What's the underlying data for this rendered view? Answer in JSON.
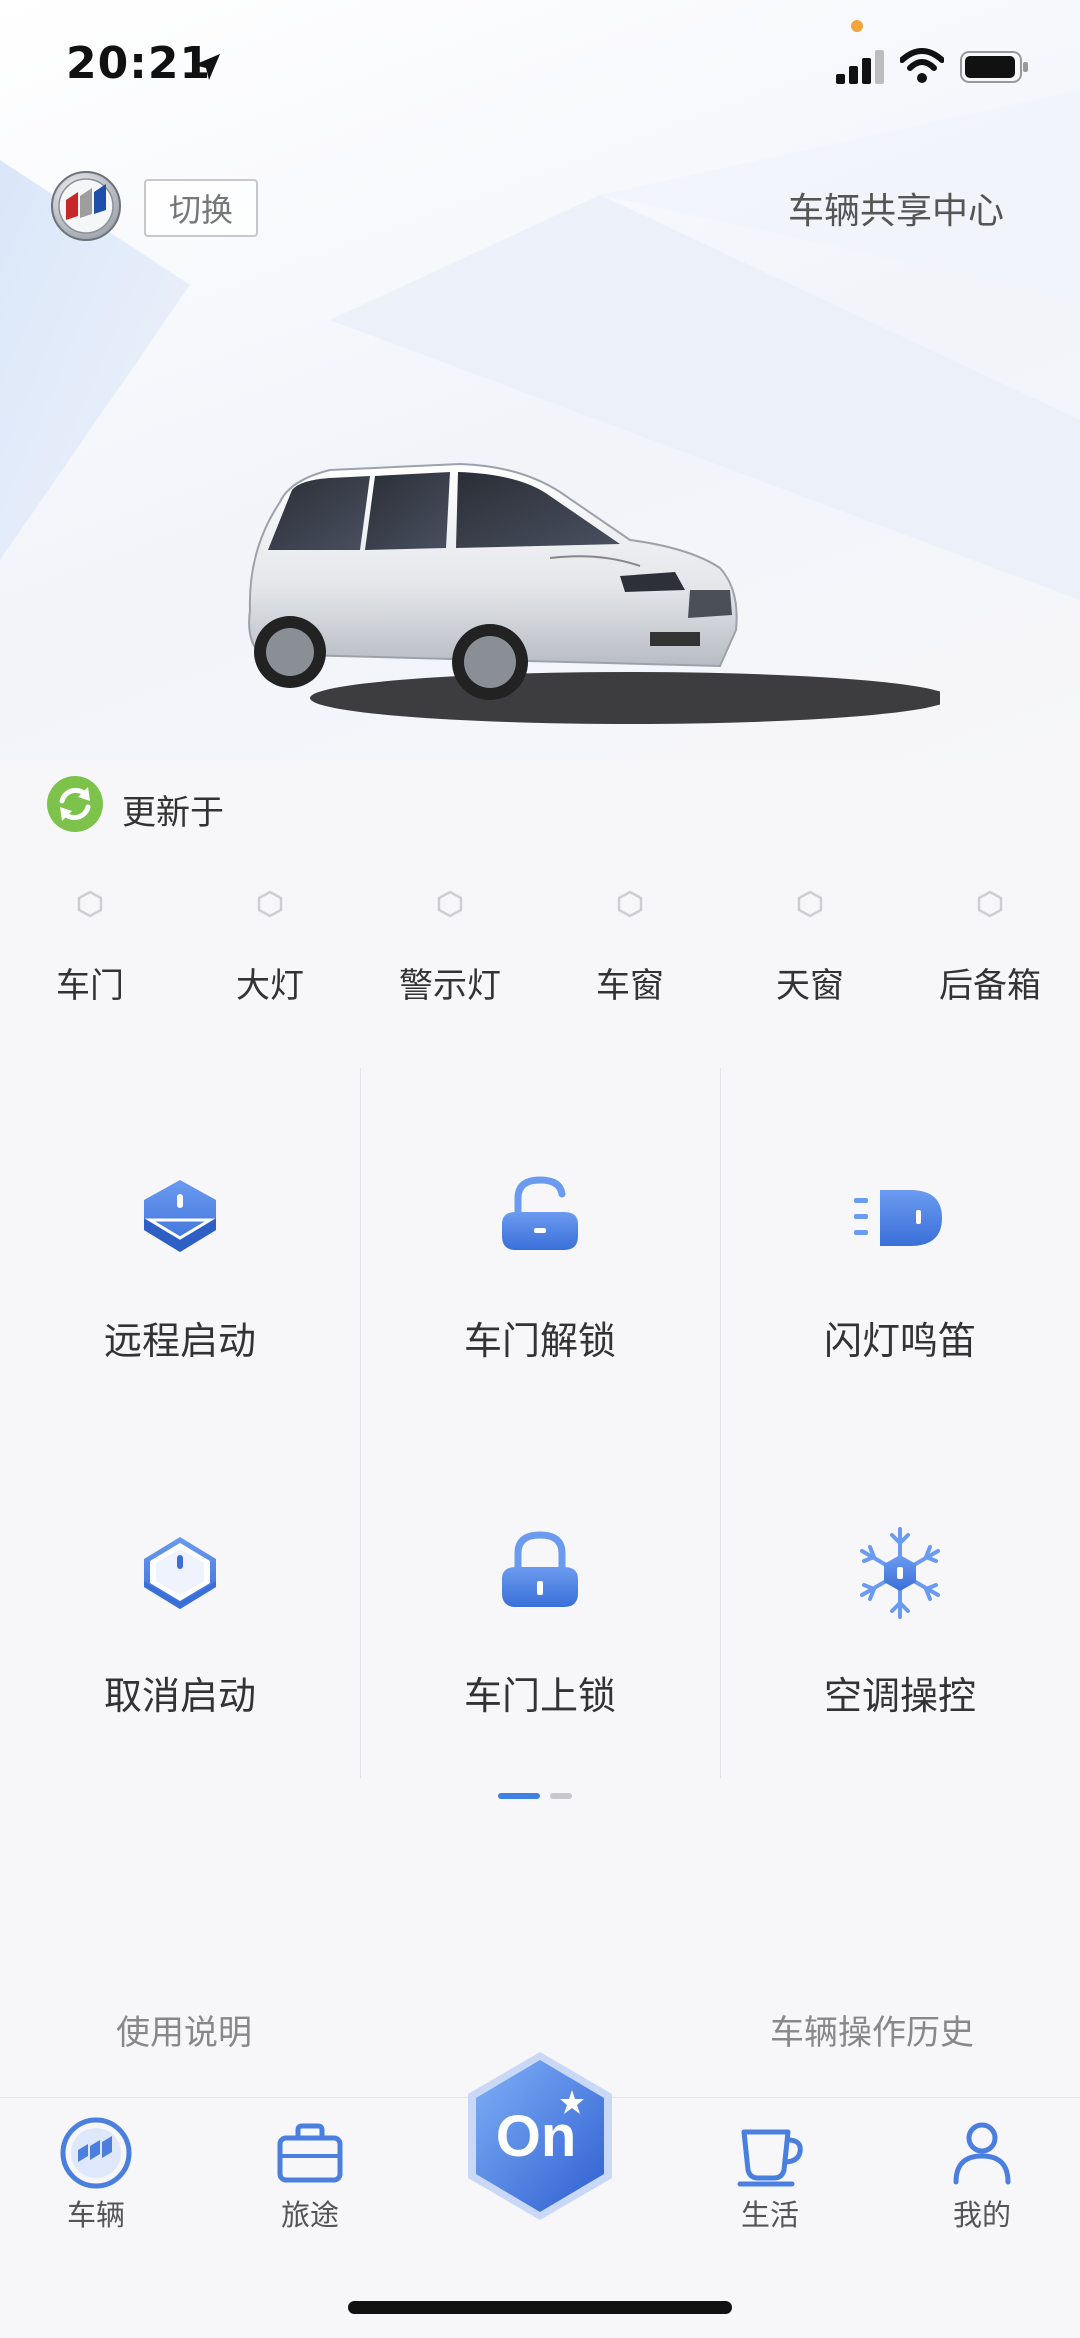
{
  "status_bar": {
    "time": "20:21"
  },
  "header": {
    "switch_label": "切换",
    "share_center": "车辆共享中心"
  },
  "update": {
    "label": "更新于"
  },
  "vehicle_status": [
    {
      "label": "车门"
    },
    {
      "label": "大灯"
    },
    {
      "label": "警示灯"
    },
    {
      "label": "车窗"
    },
    {
      "label": "天窗"
    },
    {
      "label": "后备箱"
    }
  ],
  "controls": [
    {
      "label": "远程启动",
      "icon": "remote-start-icon"
    },
    {
      "label": "车门解锁",
      "icon": "unlock-icon"
    },
    {
      "label": "闪灯鸣笛",
      "icon": "flash-horn-icon"
    },
    {
      "label": "取消启动",
      "icon": "cancel-start-icon"
    },
    {
      "label": "车门上锁",
      "icon": "lock-icon"
    },
    {
      "label": "空调操控",
      "icon": "ac-icon"
    }
  ],
  "pager": {
    "current": 1,
    "total": 2
  },
  "links": {
    "manual": "使用说明",
    "history": "车辆操作历史"
  },
  "tabbar": {
    "tabs": [
      {
        "label": "车辆",
        "icon": "vehicle-icon"
      },
      {
        "label": "旅途",
        "icon": "briefcase-icon"
      },
      {
        "label": "生活",
        "icon": "cup-icon"
      },
      {
        "label": "我的",
        "icon": "person-icon"
      }
    ],
    "center_label": "On"
  },
  "colors": {
    "accent": "#3f80e4",
    "icon_blue": "#4a7fe0",
    "refresh_green": "#7dc24a"
  }
}
